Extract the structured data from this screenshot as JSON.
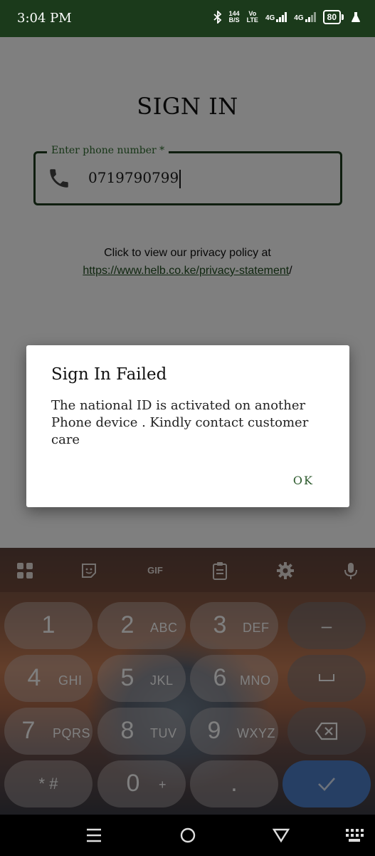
{
  "status_bar": {
    "time": "3:04 PM",
    "net_speed_value": "144",
    "net_speed_unit": "B/S",
    "volte_top": "Vo",
    "volte_bottom": "LTE",
    "sim1_type": "4G",
    "sim2_type": "4G",
    "battery_level": "80",
    "icons": [
      "bluetooth-icon",
      "signal-icon",
      "battery-icon",
      "flask-icon"
    ]
  },
  "app": {
    "title": "SIGN IN",
    "phone_field": {
      "label": "Enter phone number *",
      "value": "0719790799",
      "icon": "phone-icon"
    },
    "privacy": {
      "text": "Click to view our privacy policy at",
      "link": "https://www.helb.co.ke/privacy-statement",
      "suffix": "/"
    }
  },
  "dialog": {
    "title": "Sign In Failed",
    "message": "The national ID is activated on another Phone device . Kindly contact customer care",
    "ok_label": "OK"
  },
  "keyboard": {
    "toolbar": [
      "apps-grid-icon",
      "sticker-icon",
      "GIF",
      "clipboard-icon",
      "settings-gear-icon",
      "microphone-icon"
    ],
    "gif_label": "GIF",
    "keys": [
      {
        "num": "1",
        "sub": ""
      },
      {
        "num": "2",
        "sub": "ABC"
      },
      {
        "num": "3",
        "sub": "DEF"
      },
      {
        "num": "4",
        "sub": "GHI"
      },
      {
        "num": "5",
        "sub": "JKL"
      },
      {
        "num": "6",
        "sub": "MNO"
      },
      {
        "num": "7",
        "sub": "PQRS"
      },
      {
        "num": "8",
        "sub": "TUV"
      },
      {
        "num": "9",
        "sub": "WXYZ"
      },
      {
        "num": "* #",
        "sub": ""
      },
      {
        "num": "0",
        "sub": "+"
      },
      {
        "num": ".",
        "sub": ""
      }
    ],
    "side_keys": [
      "minus-key",
      "space-key",
      "backspace-icon",
      "done-check-icon"
    ],
    "minus_label": "–",
    "accent_color": "#4d7ec9"
  },
  "nav_bar": {
    "buttons": [
      "menu-lines-icon",
      "home-circle-icon",
      "back-triangle-icon",
      "keyboard-switch-icon"
    ]
  },
  "colors": {
    "status_bar_bg": "#1b3a1b",
    "field_border": "#1e3d1e",
    "label_green": "#2c6a2c"
  }
}
